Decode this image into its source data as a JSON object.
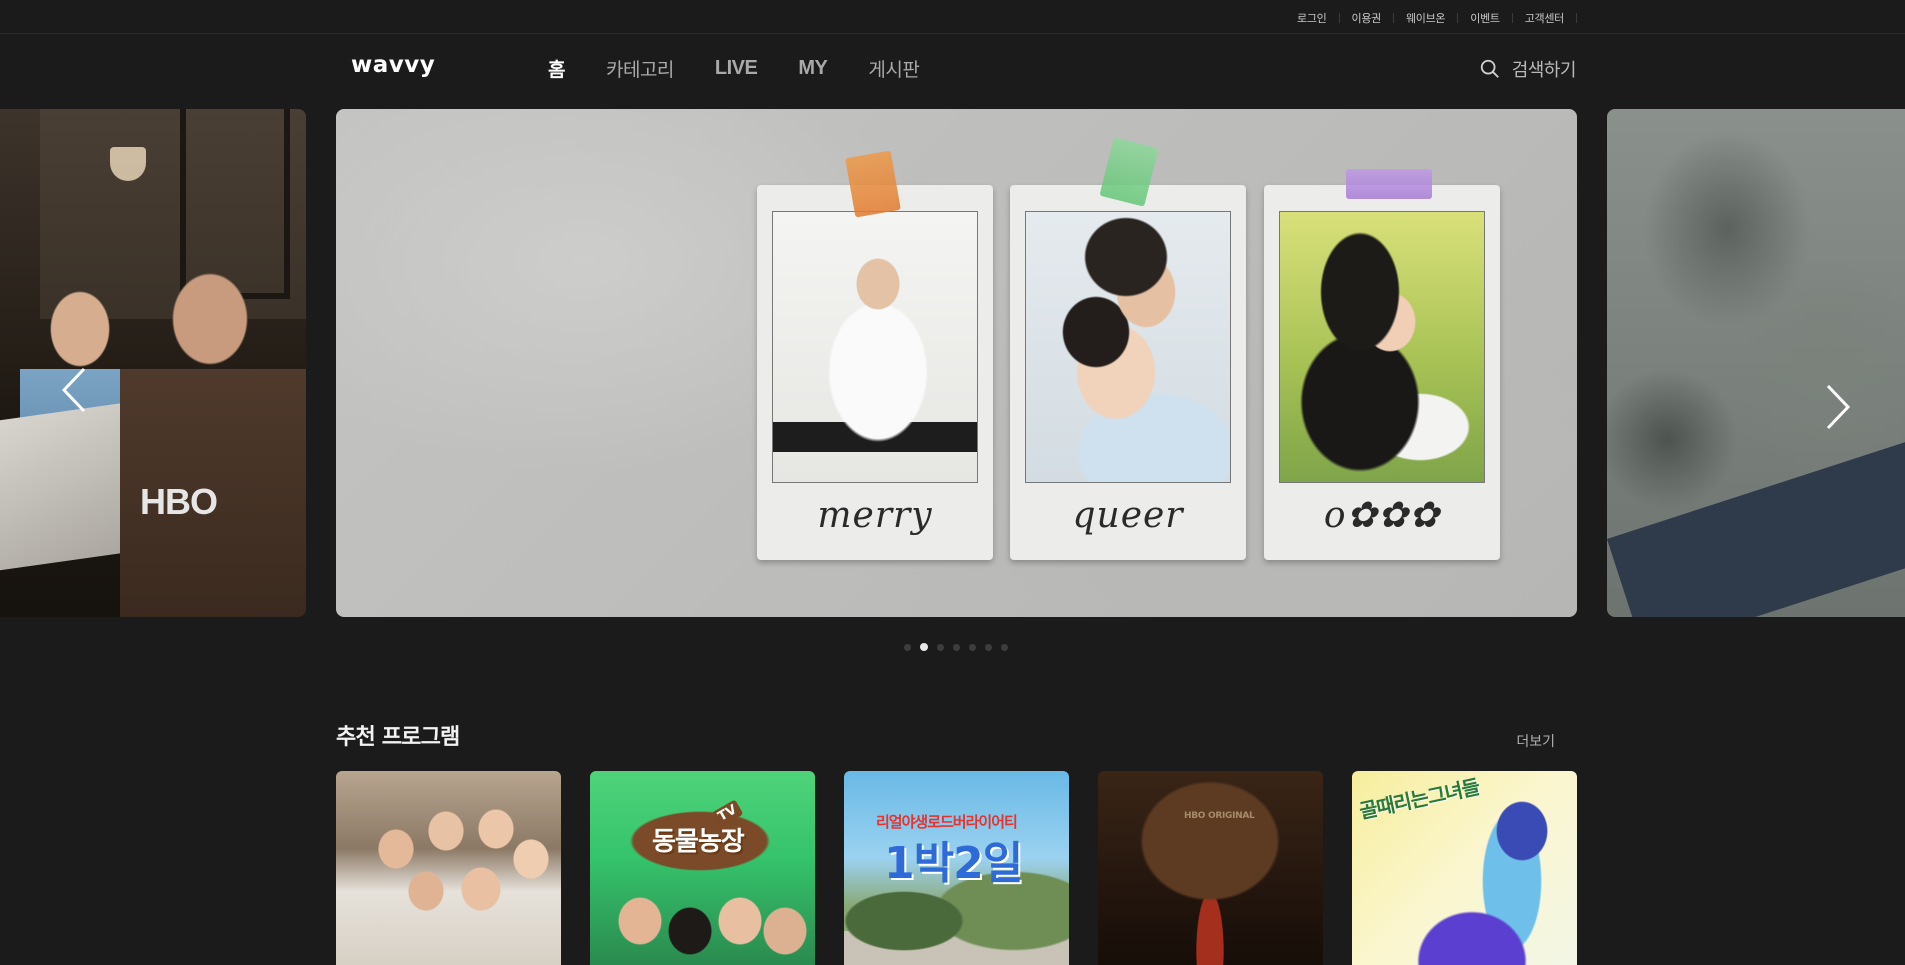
{
  "utility_links": [
    "로그인",
    "이용권",
    "웨이브온",
    "이벤트",
    "고객센터"
  ],
  "header": {
    "logo": "wavvy",
    "nav": [
      "홈",
      "카테고리",
      "LIVE",
      "MY",
      "게시판"
    ],
    "search_label": "검색하기"
  },
  "hero": {
    "prev_slide_brand": "HBO",
    "main_slide_captions": [
      "merry",
      "queer",
      "o✿✿✿"
    ],
    "dots_count": 7,
    "active_dot_index": 1
  },
  "recommended": {
    "title": "추천 프로그램",
    "more_label": "더보기",
    "cards": [
      {
        "poster_text": ""
      },
      {
        "poster_text": "동물농장",
        "poster_badge": "TV"
      },
      {
        "poster_sub": "리얼야생로드버라이어티",
        "poster_text": "1박2일"
      },
      {
        "poster_sub": "HBO ORIGINAL",
        "poster_text": ""
      },
      {
        "poster_text": "골때리는그녀들"
      }
    ]
  },
  "colors": {
    "background": "#1b1b1b",
    "nav_active": "#ffffff",
    "nav_inactive": "#a9a9a9"
  },
  "icons": [
    "search-icon",
    "chevron-left-icon",
    "chevron-right-icon"
  ]
}
